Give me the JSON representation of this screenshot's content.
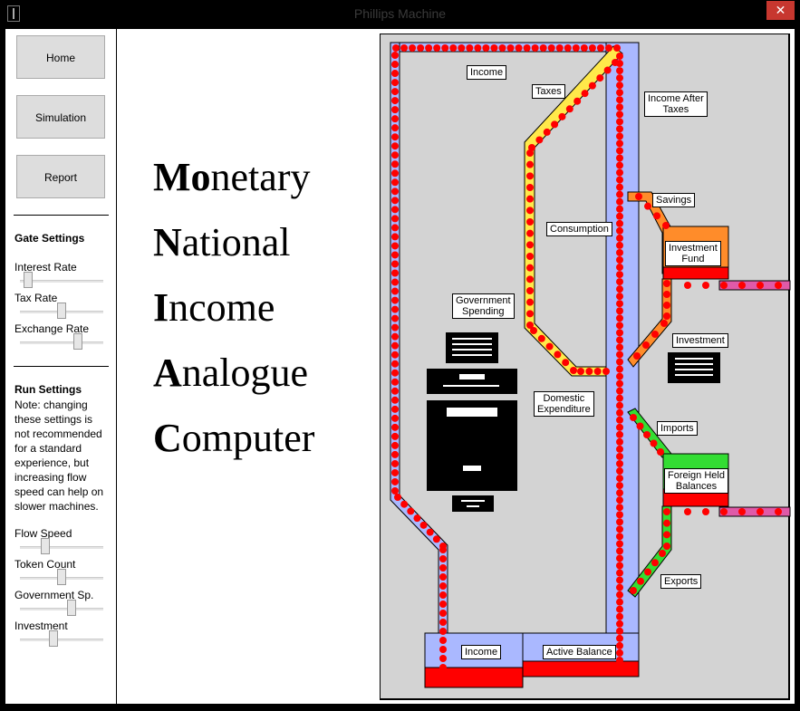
{
  "window": {
    "title": "Phillips Machine",
    "close_glyph": "✕"
  },
  "nav": {
    "home": "Home",
    "simulation": "Simulation",
    "report": "Report"
  },
  "gate_settings": {
    "title": "Gate Settings",
    "sliders": [
      {
        "label": "Interest Rate",
        "value": 0.1
      },
      {
        "label": "Tax Rate",
        "value": 0.5
      },
      {
        "label": "Exchange Rate",
        "value": 0.7
      }
    ]
  },
  "run_settings": {
    "title": "Run Settings",
    "note": "Note: changing these settings is not recommended for a standard experience, but increasing flow speed can help on slower machines.",
    "sliders": [
      {
        "label": "Flow Speed",
        "value": 0.3
      },
      {
        "label": "Token Count",
        "value": 0.5
      },
      {
        "label": "Government Sp.",
        "value": 0.62
      },
      {
        "label": "Investment",
        "value": 0.4
      }
    ]
  },
  "acronym": [
    {
      "caps": "Mo",
      "rest": "netary"
    },
    {
      "caps": "N",
      "rest": "ational"
    },
    {
      "caps": "I",
      "rest": "ncome"
    },
    {
      "caps": "A",
      "rest": "nalogue"
    },
    {
      "caps": "C",
      "rest": "omputer"
    }
  ],
  "diagram_labels": {
    "income_top": "Income",
    "taxes": "Taxes",
    "income_after_taxes_1": "Income After",
    "income_after_taxes_2": "Taxes",
    "savings": "Savings",
    "consumption": "Consumption",
    "investment_fund_1": "Investment",
    "investment_fund_2": "Fund",
    "government_spending_1": "Government",
    "government_spending_2": "Spending",
    "investment": "Investment",
    "domestic_expenditure_1": "Domestic",
    "domestic_expenditure_2": "Expenditure",
    "imports": "Imports",
    "foreign_held_balances_1": "Foreign Held",
    "foreign_held_balances_2": "Balances",
    "exports": "Exports",
    "income_bottom": "Income",
    "active_balance": "Active Balance"
  },
  "colors": {
    "flow_red": "#ff0000",
    "pipe_blue": "#aab8ff",
    "taxes_yellow": "#ffe94a",
    "savings_orange": "#ff8c2a",
    "trade_green": "#33dd33",
    "outflow_pink": "#e05aa8",
    "tank_gray": "#d3d3d3"
  }
}
